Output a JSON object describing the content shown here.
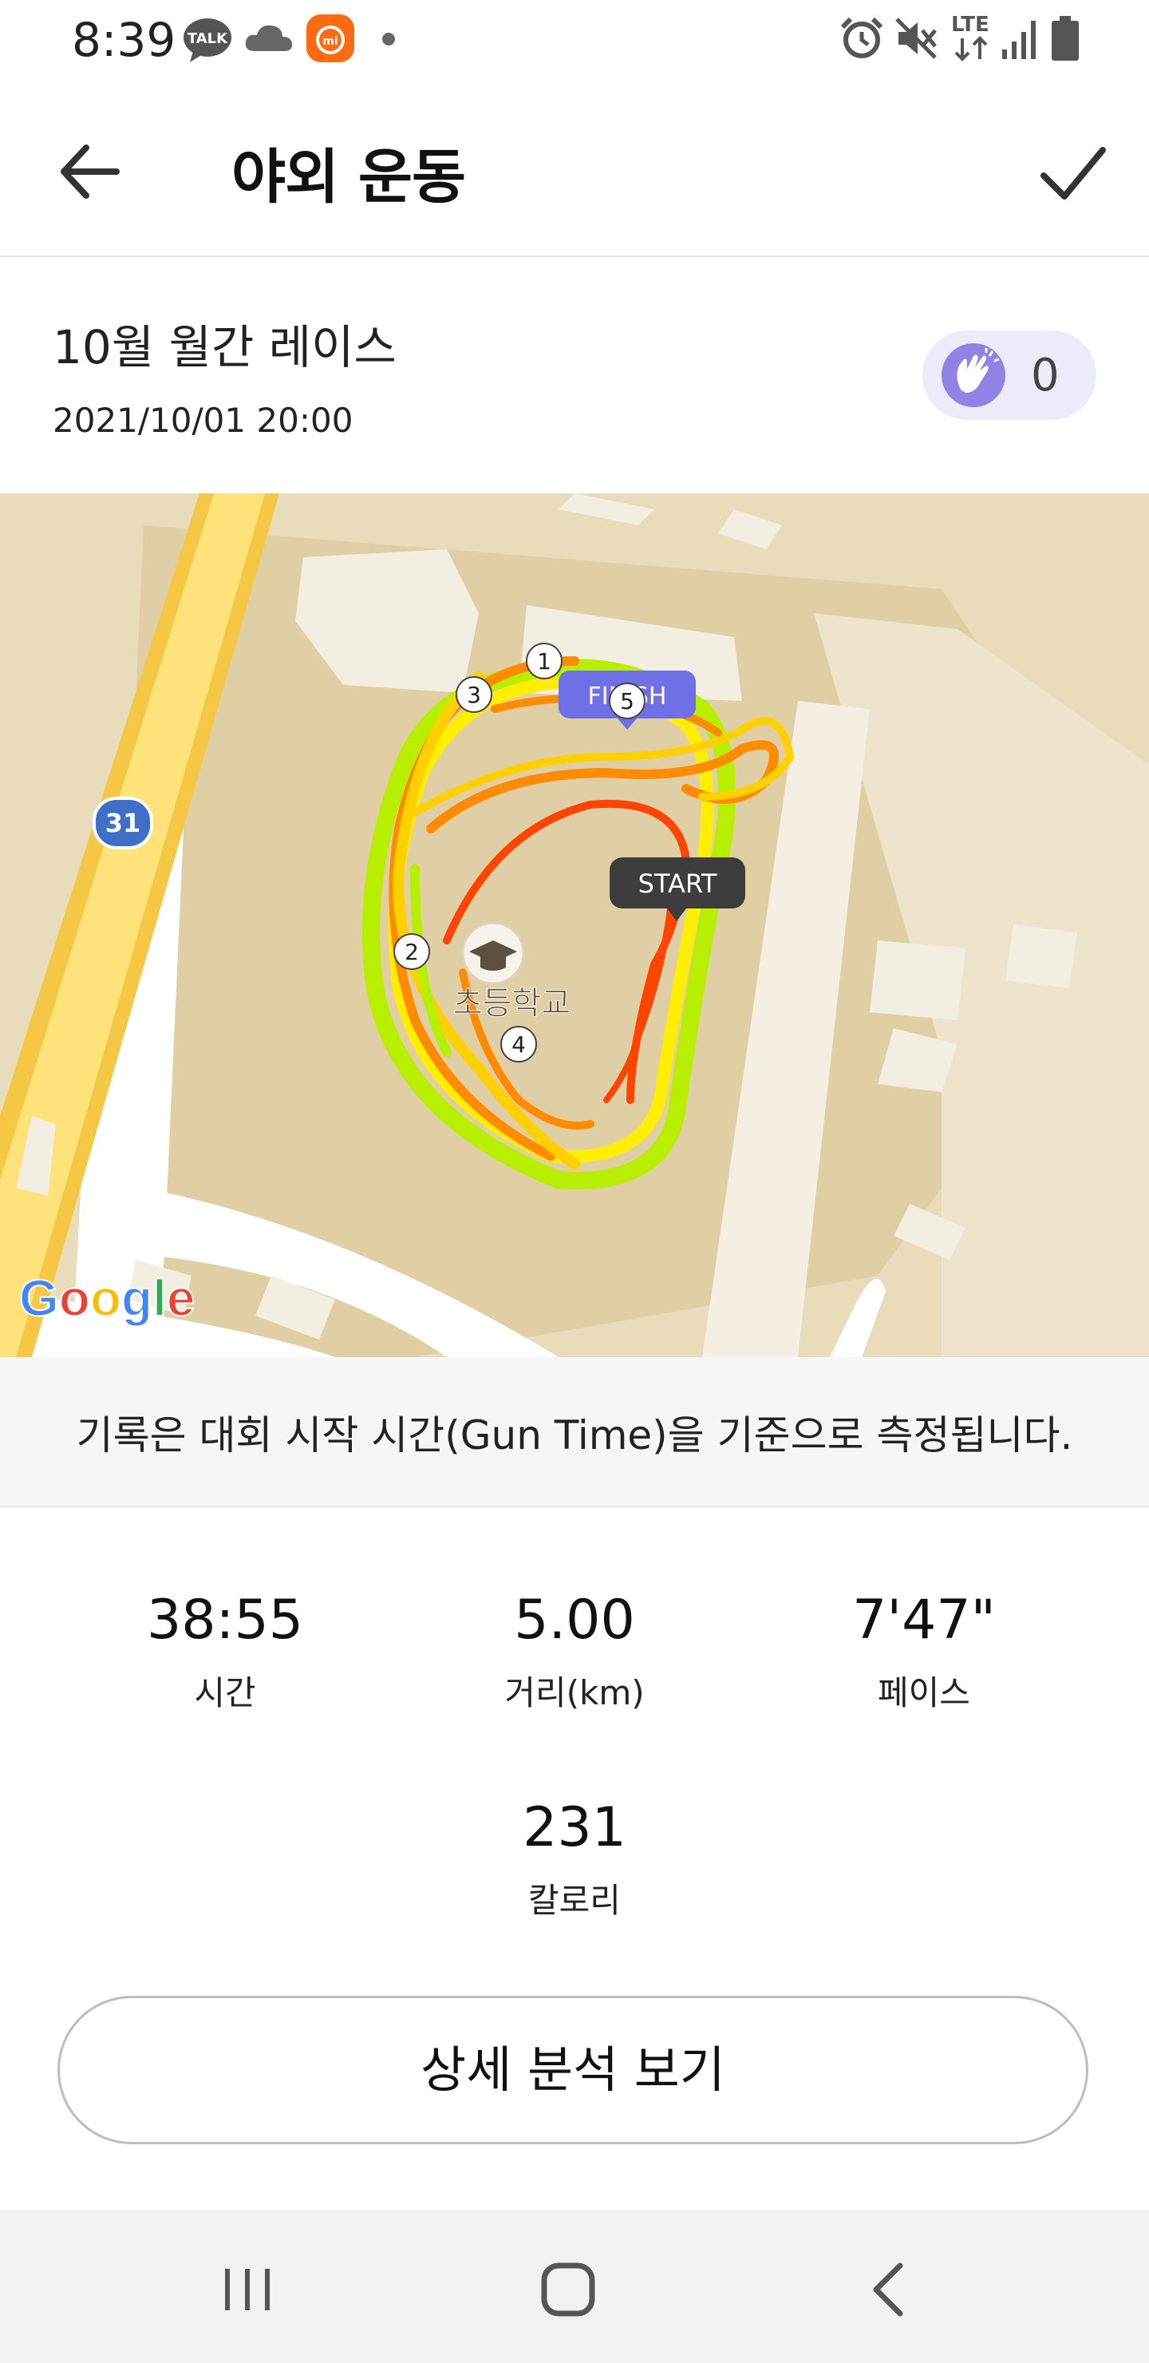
{
  "status_bar": {
    "time": "8:39",
    "icons": [
      "kakaotalk-icon",
      "cloud-icon",
      "mi-app-icon",
      "dot-icon",
      "alarm-icon",
      "mute-icon",
      "lte-icon",
      "signal-icon",
      "battery-icon"
    ],
    "lte_label": "LTE"
  },
  "app_bar": {
    "title": "야외 운동",
    "back_icon": "arrow-left-icon",
    "confirm_icon": "check-icon"
  },
  "race": {
    "title": "10월 월간 레이스",
    "datetime": "2021/10/01 20:00",
    "clap_count": "0"
  },
  "map": {
    "road_number": "31",
    "school_label": "초등학교",
    "finish_label": "FINISH",
    "start_label": "START",
    "km_markers": [
      "1",
      "2",
      "3",
      "4",
      "5"
    ],
    "google_logo": "Google",
    "route_colors": [
      "#ff4400",
      "#ff8c00",
      "#ffd000",
      "#ffee00",
      "#b8ee00"
    ]
  },
  "notice": "기록은 대회 시작 시간(Gun Time)을 기준으로 측정됩니다.",
  "stats": {
    "time": {
      "value": "38:55",
      "label": "시간"
    },
    "distance": {
      "value": "5.00",
      "label": "거리(km)"
    },
    "pace": {
      "value": "7'47\"",
      "label": "페이스"
    },
    "calories": {
      "value": "231",
      "label": "칼로리"
    }
  },
  "detail_button": "상세 분석 보기",
  "nav_bar": {
    "icons": [
      "recent-apps-icon",
      "home-icon",
      "back-icon"
    ]
  }
}
